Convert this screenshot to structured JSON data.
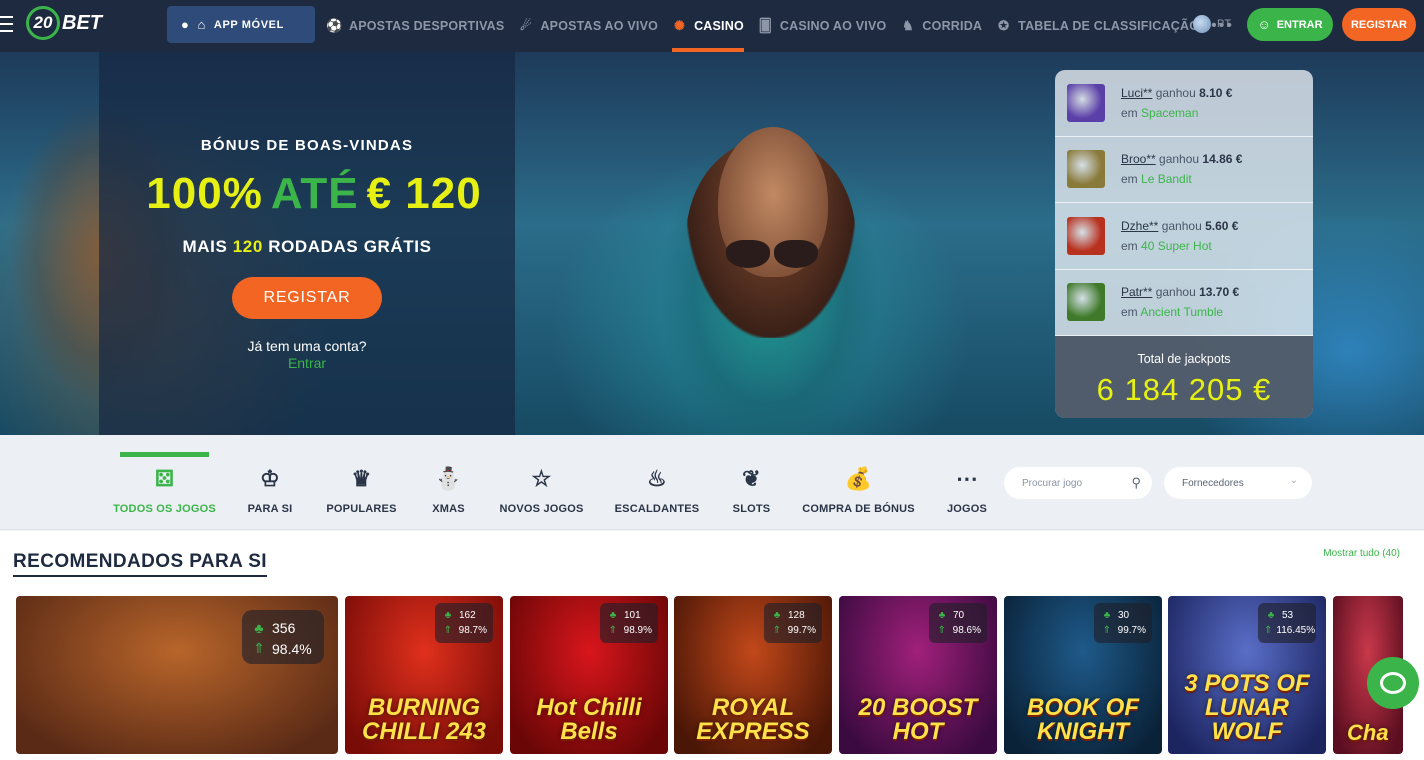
{
  "header": {
    "logo_text": "BET",
    "logo_badge": "20",
    "app_label": "APP MÓVEL",
    "nav": [
      {
        "label": "APOSTAS DESPORTIVAS",
        "icon": "soccer-ball-icon",
        "glyph": "⚽",
        "active": false
      },
      {
        "label": "APOSTAS AO VIVO",
        "icon": "live-icon",
        "glyph": "☄",
        "active": false
      },
      {
        "label": "CASINO",
        "icon": "roulette-icon",
        "glyph": "✺",
        "active": true
      },
      {
        "label": "CASINO AO VIVO",
        "icon": "cards-icon",
        "glyph": "🂠",
        "active": false
      },
      {
        "label": "CORRIDA",
        "icon": "horse-icon",
        "glyph": "♞",
        "active": false
      },
      {
        "label": "TABELA DE CLASSIFICAÇÃO",
        "icon": "trophy-icon",
        "glyph": "✪",
        "active": false
      }
    ],
    "more": "•••",
    "lang": "PT",
    "login_label": "ENTRAR",
    "register_label": "REGISTAR"
  },
  "hero": {
    "bonus_title": "BÓNUS DE BOAS-VINDAS",
    "bonus_percent": "100%",
    "bonus_upto": "ATÉ",
    "bonus_amount": "€ 120",
    "sub_prefix": "MAIS",
    "sub_highlight": "120",
    "sub_suffix": "RODADAS GRÁTIS",
    "register_label": "REGISTAR",
    "has_account": "Já tem uma conta?",
    "enter_link": "Entrar"
  },
  "winners": {
    "items": [
      {
        "name": "Luci**",
        "won": "ganhou",
        "amount": "8.10 €",
        "prefix": "em",
        "game": "Spaceman",
        "color": "#5b3fa8"
      },
      {
        "name": "Broo**",
        "won": "ganhou",
        "amount": "14.86 €",
        "prefix": "em",
        "game": "Le Bandit",
        "color": "#8a7a3a"
      },
      {
        "name": "Dzhe**",
        "won": "ganhou",
        "amount": "5.60 €",
        "prefix": "em",
        "game": "40 Super Hot",
        "color": "#b8301e"
      },
      {
        "name": "Patr**",
        "won": "ganhou",
        "amount": "13.70 €",
        "prefix": "em",
        "game": "Ancient Tumble",
        "color": "#3f7a2a"
      }
    ],
    "jackpot_label": "Total de jackpots",
    "jackpot_value": "6 184 205 €"
  },
  "categories": [
    {
      "label": "TODOS OS JOGOS",
      "icon": "dice-icon",
      "glyph": "⚄",
      "active": true
    },
    {
      "label": "PARA SI",
      "icon": "user-star-icon",
      "glyph": "♔",
      "active": false
    },
    {
      "label": "POPULARES",
      "icon": "crown-icon",
      "glyph": "♛",
      "active": false
    },
    {
      "label": "XMAS",
      "icon": "santa-hat-icon",
      "glyph": "⛄",
      "active": false
    },
    {
      "label": "NOVOS JOGOS",
      "icon": "star-icon",
      "glyph": "☆",
      "active": false
    },
    {
      "label": "ESCALDANTES",
      "icon": "chili-icon",
      "glyph": "♨",
      "active": false
    },
    {
      "label": "SLOTS",
      "icon": "cherry-icon",
      "glyph": "❦",
      "active": false
    },
    {
      "label": "COMPRA DE BÓNUS",
      "icon": "money-bag-icon",
      "glyph": "💰",
      "active": false
    },
    {
      "label": "JOGOS",
      "icon": "more-games-icon",
      "glyph": "⋯",
      "active": false
    }
  ],
  "search": {
    "placeholder": "Procurar jogo"
  },
  "providers": {
    "label": "Fornecedores"
  },
  "recommended": {
    "title": "RECOMENDADOS PARA SI",
    "show_all": "Mostrar tudo",
    "count": "(40)",
    "games": [
      {
        "title": "",
        "players": "356",
        "rtp": "98.4%",
        "bg": "#b8652a",
        "bg2": "#5a2a16"
      },
      {
        "title": "BURNING CHILLI 243",
        "players": "162",
        "rtp": "98.7%",
        "bg": "#e0301c",
        "bg2": "#7a0c08"
      },
      {
        "title": "Hot Chilli Bells",
        "players": "101",
        "rtp": "98.9%",
        "bg": "#d8161c",
        "bg2": "#6a0606"
      },
      {
        "title": "ROYAL EXPRESS",
        "players": "128",
        "rtp": "99.7%",
        "bg": "#c2481a",
        "bg2": "#4a1606"
      },
      {
        "title": "20 BOOST HOT",
        "players": "70",
        "rtp": "98.6%",
        "bg": "#a0207a",
        "bg2": "#3a0a40"
      },
      {
        "title": "BOOK OF KNIGHT",
        "players": "30",
        "rtp": "99.7%",
        "bg": "#1e5a8a",
        "bg2": "#0a2238"
      },
      {
        "title": "3 POTS OF LUNAR WOLF",
        "players": "53",
        "rtp": "116.45%",
        "bg": "#5a6ec8",
        "bg2": "#1c2560"
      },
      {
        "title": "Cha",
        "players": "",
        "rtp": "",
        "bg": "#c8384a",
        "bg2": "#5a0e20"
      }
    ]
  }
}
